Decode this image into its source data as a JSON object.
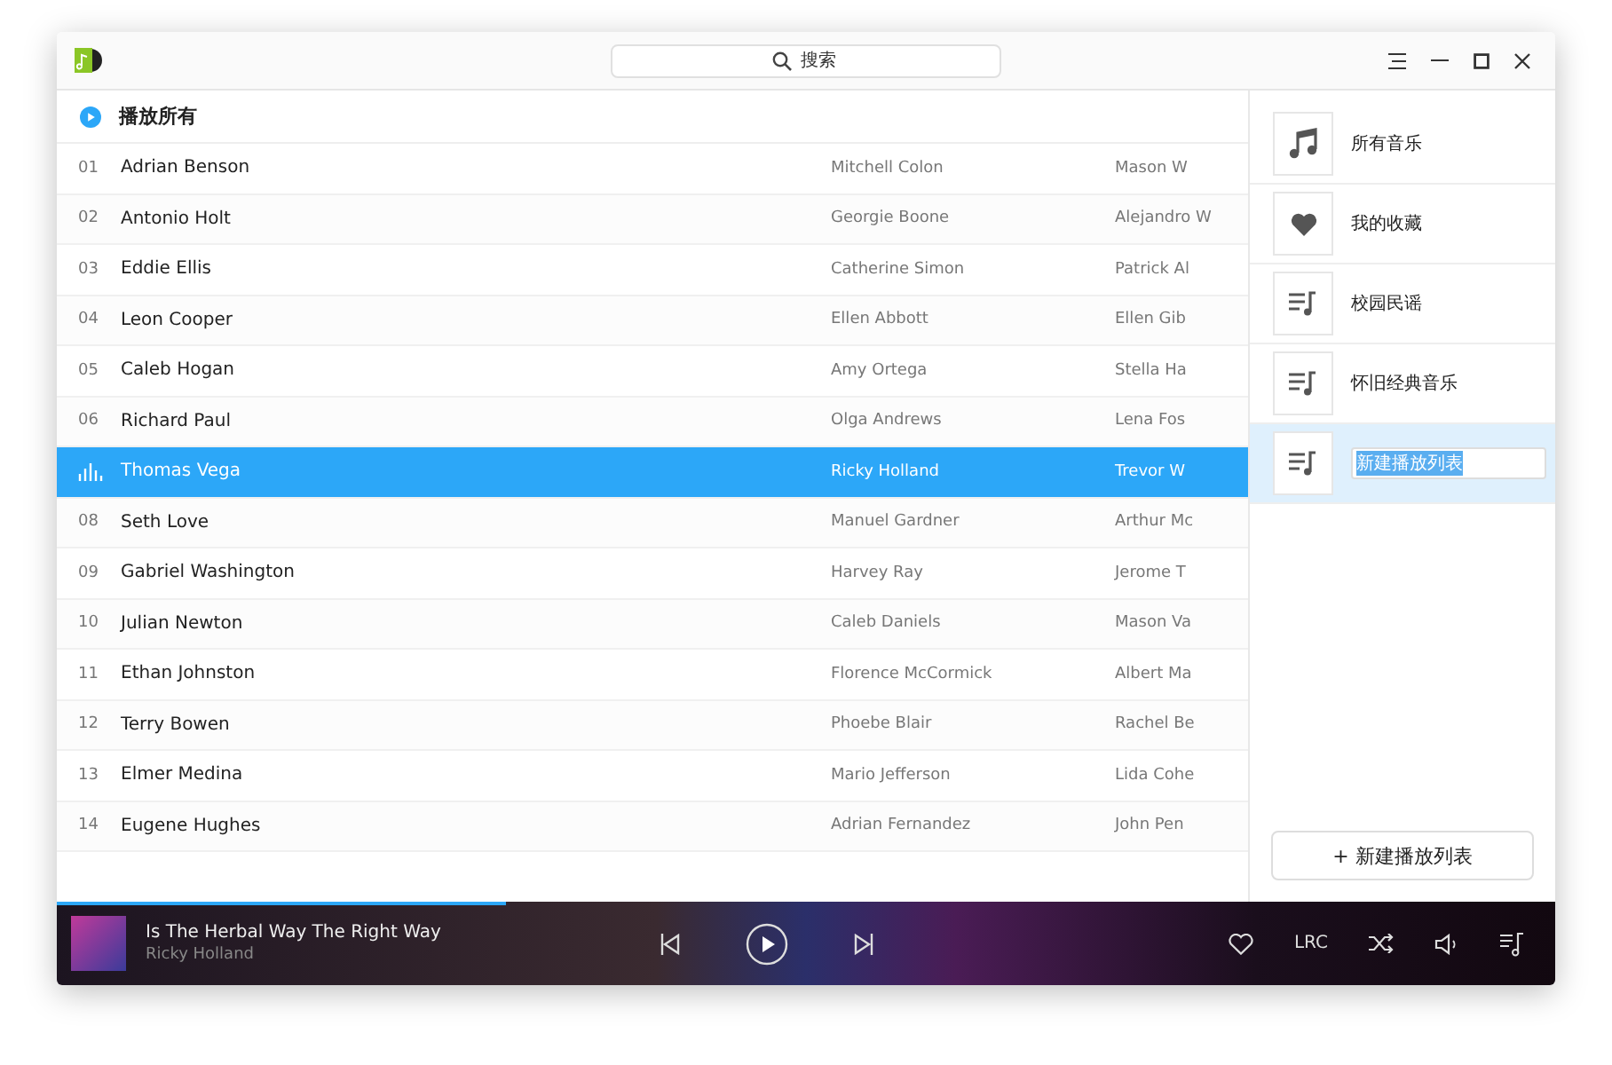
{
  "search": {
    "placeholder": "搜索"
  },
  "header": {
    "play_all": "播放所有"
  },
  "rows": [
    {
      "number": "01",
      "title": "Adrian Benson",
      "artist": "Mitchell Colon",
      "column_3": "Mason W",
      "selected": false
    },
    {
      "number": "02",
      "title": "Antonio Holt",
      "artist": "Georgie Boone",
      "column_3": "Alejandro W",
      "selected": false
    },
    {
      "number": "03",
      "title": "Eddie Ellis",
      "artist": "Catherine Simon",
      "column_3": "Patrick Al",
      "selected": false
    },
    {
      "number": "04",
      "title": "Leon Cooper",
      "artist": "Ellen Abbott",
      "column_3": "Ellen Gib",
      "selected": false
    },
    {
      "number": "05",
      "title": "Caleb Hogan",
      "artist": "Amy Ortega",
      "column_3": "Stella Ha",
      "selected": false
    },
    {
      "number": "06",
      "title": "Richard Paul",
      "artist": "Olga Andrews",
      "column_3": "Lena Fos",
      "selected": false
    },
    {
      "title": "Thomas Vega",
      "artist": "Ricky Holland",
      "column_3": "Trevor W",
      "selected": true
    },
    {
      "number": "08",
      "title": "Seth Love",
      "artist": "Manuel Gardner",
      "column_3": "Arthur Mc",
      "selected": false
    },
    {
      "number": "09",
      "title": "Gabriel Washington",
      "artist": "Harvey Ray",
      "column_3": "Jerome T",
      "selected": false
    },
    {
      "number": "10",
      "title": "Julian Newton",
      "artist": "Caleb Daniels",
      "column_3": "Mason Va",
      "selected": false
    },
    {
      "number": "11",
      "title": "Ethan Johnston",
      "artist": "Florence McCormick",
      "column_3": "Albert Ma",
      "selected": false
    },
    {
      "number": "12",
      "title": "Terry Bowen",
      "artist": "Phoebe Blair",
      "column_3": "Rachel Be",
      "selected": false
    },
    {
      "number": "13",
      "title": "Elmer Medina",
      "artist": "Mario Jefferson",
      "column_3": "Lida Cohe",
      "selected": false
    },
    {
      "number": "14",
      "title": "Eugene Hughes",
      "artist": "Adrian Fernandez",
      "column_3": "John Pen",
      "selected": false
    }
  ],
  "playlists": [
    {
      "kind": "music",
      "label": "所有音乐",
      "selected": false,
      "editing": false
    },
    {
      "kind": "heart",
      "label": "我的收藏",
      "selected": false,
      "editing": false
    },
    {
      "kind": "playlist",
      "label": "校园民谣",
      "selected": false,
      "editing": false
    },
    {
      "kind": "playlist",
      "label": "怀旧经典音乐",
      "selected": false,
      "editing": false
    },
    {
      "kind": "playlist",
      "label": "新建播放列表",
      "selected": true,
      "editing": true
    }
  ],
  "new_playlist_button": "+ 新建播放列表",
  "player": {
    "title": "Is The Herbal Way The Right Way",
    "artist": "Ricky Holland",
    "level": 0.3,
    "lyrics_button": "LRC"
  }
}
